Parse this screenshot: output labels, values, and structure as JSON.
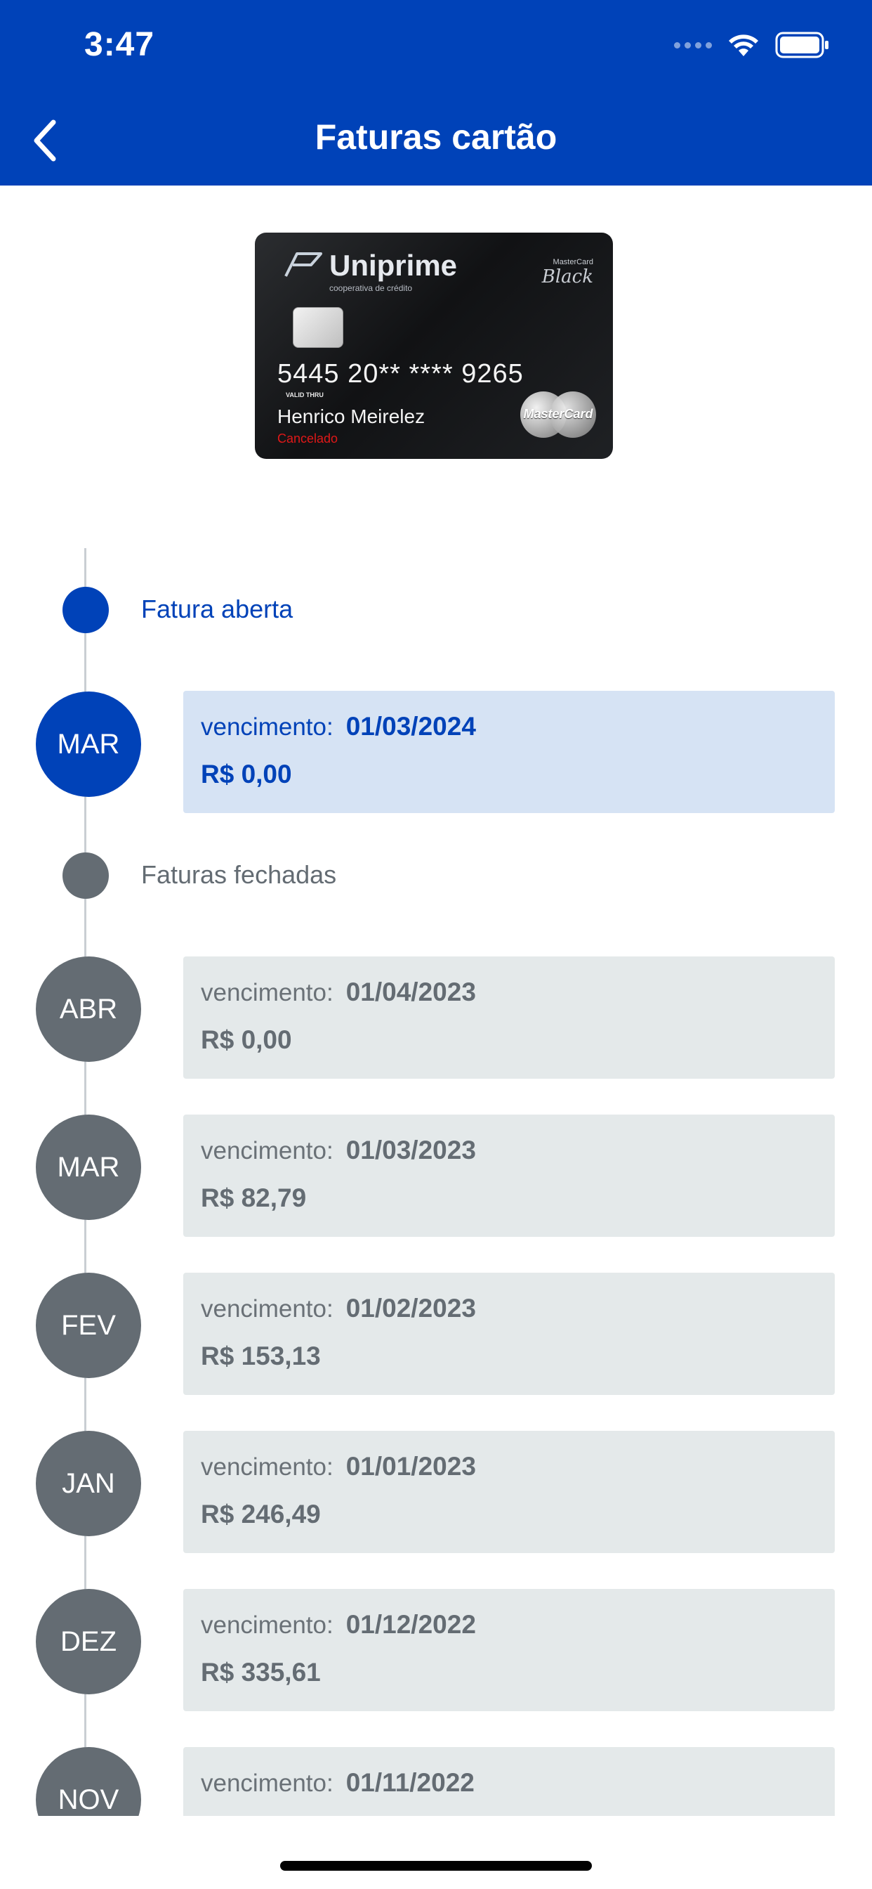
{
  "status_bar": {
    "time": "3:47"
  },
  "nav": {
    "title": "Faturas cartão"
  },
  "card": {
    "brand": "Uniprime",
    "brand_sub": "cooperativa de crédito",
    "tier_small": "MasterCard",
    "tier_name": "Black",
    "number": "5445 20** **** 9265",
    "valid_thru": "VALID THRU",
    "holder": "Henrico Meirelez",
    "status": "Cancelado",
    "network": "MasterCard"
  },
  "open_section": {
    "label": "Fatura aberta",
    "invoice": {
      "month": "MAR",
      "due_label": "vencimento:",
      "due_date": "01/03/2024",
      "amount": "R$ 0,00"
    }
  },
  "closed_section": {
    "label": "Faturas fechadas",
    "invoices": [
      {
        "month": "ABR",
        "due_label": "vencimento:",
        "due_date": "01/04/2023",
        "amount": "R$ 0,00"
      },
      {
        "month": "MAR",
        "due_label": "vencimento:",
        "due_date": "01/03/2023",
        "amount": "R$ 82,79"
      },
      {
        "month": "FEV",
        "due_label": "vencimento:",
        "due_date": "01/02/2023",
        "amount": "R$ 153,13"
      },
      {
        "month": "JAN",
        "due_label": "vencimento:",
        "due_date": "01/01/2023",
        "amount": "R$ 246,49"
      },
      {
        "month": "DEZ",
        "due_label": "vencimento:",
        "due_date": "01/12/2022",
        "amount": "R$ 335,61"
      },
      {
        "month": "NOV",
        "due_label": "vencimento:",
        "due_date": "01/11/2022",
        "amount": ""
      }
    ]
  },
  "colors": {
    "primary": "#0042b8",
    "open_bg": "#d6e3f4",
    "closed_bg": "#e4e9ea",
    "closed_circle": "#646c73",
    "card_status": "#e01818"
  },
  "icons": {
    "back": "chevron-left-icon",
    "signal": "cellular-signal-icon",
    "wifi": "wifi-icon",
    "battery": "battery-icon"
  }
}
